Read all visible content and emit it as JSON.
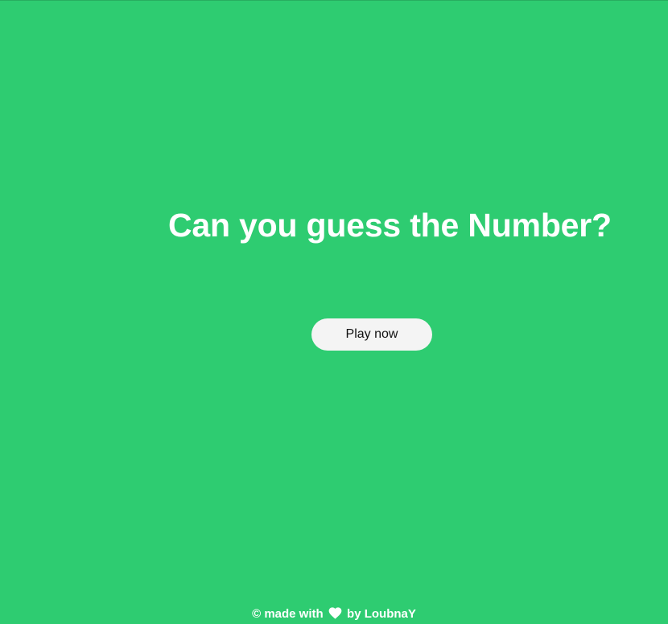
{
  "hero": {
    "title": "Can you guess the Number?"
  },
  "actions": {
    "play_label": "Play now"
  },
  "footer": {
    "prefix": "© made with",
    "icon": "heart-icon",
    "suffix": "by LoubnaY"
  },
  "colors": {
    "background": "#2ecc71",
    "text": "#ffffff",
    "button_background": "#f4f4f4",
    "button_text": "#111111"
  }
}
